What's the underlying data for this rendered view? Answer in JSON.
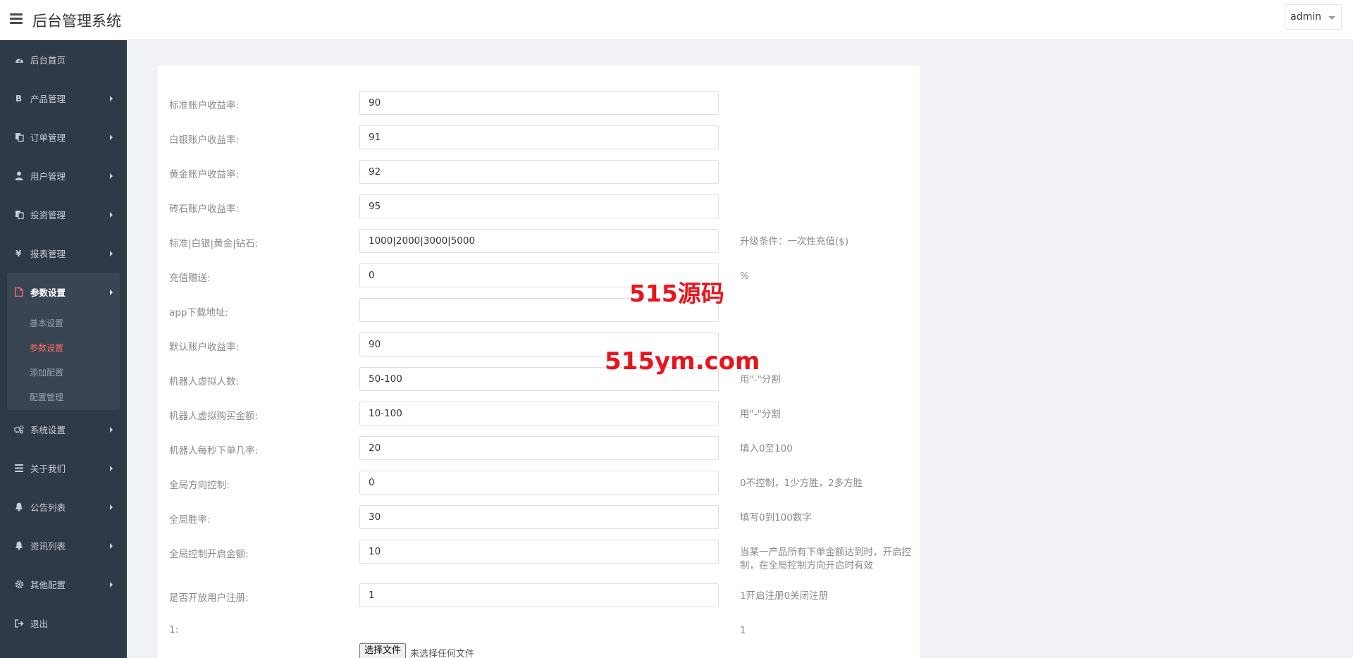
{
  "header": {
    "title": "后台管理系统",
    "user": "admin"
  },
  "sidebar": {
    "items_top": [
      {
        "label": "后台首页",
        "icon": "dashboard-icon",
        "arrow": false
      },
      {
        "label": "产品管理",
        "icon": "bitcoin-icon",
        "arrow": true
      },
      {
        "label": "订单管理",
        "icon": "copy-icon",
        "arrow": true
      },
      {
        "label": "用户管理",
        "icon": "user-icon",
        "arrow": true
      },
      {
        "label": "投资管理",
        "icon": "copy-icon",
        "arrow": true
      },
      {
        "label": "报表管理",
        "icon": "yen-icon",
        "arrow": true
      }
    ],
    "active_group": {
      "label": "参数设置",
      "icon": "file-icon",
      "children": [
        {
          "label": "基本设置",
          "active": false
        },
        {
          "label": "参数设置",
          "active": true
        },
        {
          "label": "添加配置",
          "active": false
        },
        {
          "label": "配置管理",
          "active": false
        }
      ]
    },
    "items_bottom": [
      {
        "label": "系统设置",
        "icon": "gears-icon",
        "arrow": true
      },
      {
        "label": "关于我们",
        "icon": "list-icon",
        "arrow": true
      },
      {
        "label": "公告列表",
        "icon": "bell-icon",
        "arrow": true
      },
      {
        "label": "资讯列表",
        "icon": "bell-icon",
        "arrow": true
      },
      {
        "label": "其他配置",
        "icon": "gear-icon",
        "arrow": true
      },
      {
        "label": "退出",
        "icon": "sign-out-icon",
        "arrow": false
      }
    ]
  },
  "form": {
    "rows": [
      {
        "label": "标准账户收益率:",
        "value": "90",
        "hint": ""
      },
      {
        "label": "白银账户收益率:",
        "value": "91",
        "hint": ""
      },
      {
        "label": "黄金账户收益率:",
        "value": "92",
        "hint": ""
      },
      {
        "label": "砖石账户收益率:",
        "value": "95",
        "hint": ""
      },
      {
        "label": "标准|白银|黄金|钻石:",
        "value": "1000|2000|3000|5000",
        "hint": "升级条件：一次性充值($)"
      },
      {
        "label": "充值赠送:",
        "value": "0",
        "hint": "%"
      },
      {
        "label": "app下载地址:",
        "value": "",
        "hint": ""
      },
      {
        "label": "默认账户收益率:",
        "value": "90",
        "hint": ""
      },
      {
        "label": "机器人虚拟人数:",
        "value": "50-100",
        "hint": "用\"-\"分割"
      },
      {
        "label": "机器人虚拟购买金额:",
        "value": "10-100",
        "hint": "用\"-\"分割"
      },
      {
        "label": "机器人每秒下单几率:",
        "value": "20",
        "hint": "填入0至100"
      },
      {
        "label": "全局方向控制:",
        "value": "0",
        "hint": "0不控制，1少方胜，2多方胜"
      },
      {
        "label": "全局胜率:",
        "value": "30",
        "hint": "填写0到100数字"
      },
      {
        "label": "全局控制开启金额:",
        "value": "10",
        "hint": "当某一产品所有下单金额达到时，开启控制，在全局控制方向开启时有效"
      },
      {
        "label": "是否开放用户注册:",
        "value": "1",
        "hint": "1开启注册0关闭注册"
      }
    ],
    "last_row": {
      "label": "1:",
      "hint": "1"
    },
    "file_button": "选择文件",
    "file_status": "未选择任何文件"
  },
  "watermark": {
    "line1": "515源码",
    "line2": "515ym.com"
  }
}
